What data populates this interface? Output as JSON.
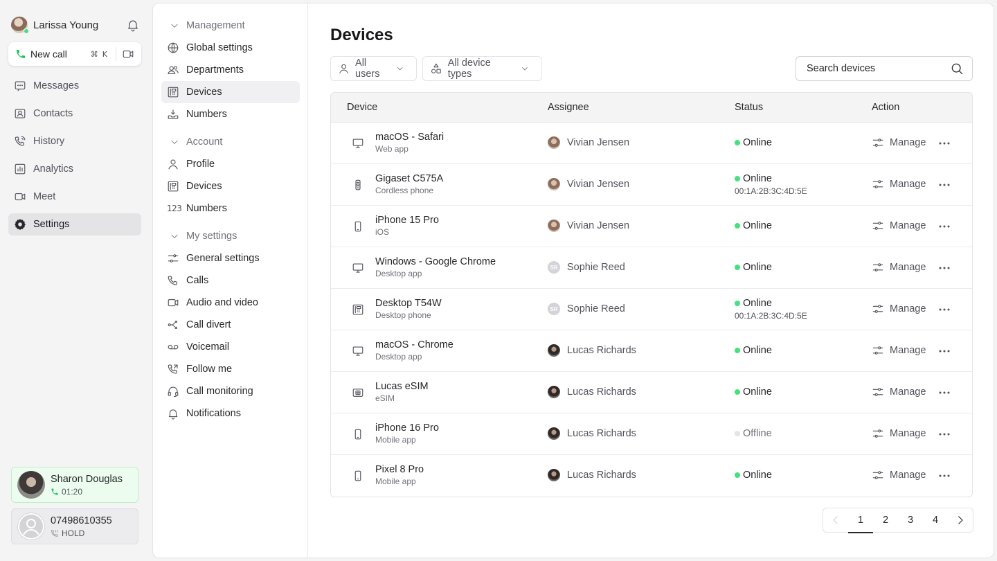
{
  "user": {
    "name": "Larissa Young",
    "status_color": "#4ade80"
  },
  "new_call": {
    "label": "New call",
    "shortcut_cmd": "⌘",
    "shortcut_key": "K"
  },
  "nav": [
    {
      "id": "messages",
      "label": "Messages",
      "icon": "chat-icon"
    },
    {
      "id": "contacts",
      "label": "Contacts",
      "icon": "contact-card-icon"
    },
    {
      "id": "history",
      "label": "History",
      "icon": "phone-history-icon"
    },
    {
      "id": "analytics",
      "label": "Analytics",
      "icon": "analytics-icon"
    },
    {
      "id": "meet",
      "label": "Meet",
      "icon": "video-icon"
    },
    {
      "id": "settings",
      "label": "Settings",
      "icon": "gear-icon",
      "active": true
    }
  ],
  "calls": {
    "active": {
      "name": "Sharon Douglas",
      "duration": "01:20"
    },
    "hold": {
      "name": "07498610355",
      "status": "HOLD"
    }
  },
  "subnav": {
    "management": {
      "title": "Management",
      "items": [
        "Global settings",
        "Departments",
        "Devices",
        "Numbers"
      ]
    },
    "account": {
      "title": "Account",
      "items": [
        "Profile",
        "Devices",
        "Numbers"
      ]
    },
    "my_settings": {
      "title": "My settings",
      "items": [
        "General settings",
        "Calls",
        "Audio and video",
        "Call divert",
        "Voicemail",
        "Follow me",
        "Call monitoring",
        "Notifications"
      ]
    }
  },
  "page": {
    "title": "Devices",
    "filters": {
      "users": "All users",
      "types": "All device types"
    },
    "search_placeholder": "Search devices"
  },
  "table": {
    "headers": {
      "device": "Device",
      "assignee": "Assignee",
      "status": "Status",
      "action": "Action"
    },
    "rows": [
      {
        "device": "macOS - Safari",
        "type": "Web app",
        "icon": "monitor-icon",
        "assignee": "Vivian Jensen",
        "avatar": "vj",
        "status": "Online",
        "mac": ""
      },
      {
        "device": "Gigaset C575A",
        "type": "Cordless phone",
        "icon": "cordless-phone-icon",
        "assignee": "Vivian Jensen",
        "avatar": "vj",
        "status": "Online",
        "mac": "00:1A:2B:3C:4D:5E"
      },
      {
        "device": "iPhone 15 Pro",
        "type": "iOS",
        "icon": "mobile-phone-icon",
        "assignee": "Vivian Jensen",
        "avatar": "vj",
        "status": "Online",
        "mac": ""
      },
      {
        "device": "Windows - Google Chrome",
        "type": "Desktop app",
        "icon": "monitor-icon",
        "assignee": "Sophie Reed",
        "avatar": "sr",
        "initials": "SR",
        "status": "Online",
        "mac": ""
      },
      {
        "device": "Desktop T54W",
        "type": "Desktop phone",
        "icon": "desk-phone-icon",
        "assignee": "Sophie Reed",
        "avatar": "sr",
        "initials": "SR",
        "status": "Online",
        "mac": "00:1A:2B:3C:4D:5E"
      },
      {
        "device": "macOS - Chrome",
        "type": "Desktop app",
        "icon": "monitor-icon",
        "assignee": "Lucas Richards",
        "avatar": "lr",
        "status": "Online",
        "mac": ""
      },
      {
        "device": "Lucas eSIM",
        "type": "eSIM",
        "icon": "esim-icon",
        "assignee": "Lucas Richards",
        "avatar": "lr",
        "status": "Online",
        "mac": ""
      },
      {
        "device": "iPhone 16 Pro",
        "type": "Mobile app",
        "icon": "mobile-phone-icon",
        "assignee": "Lucas Richards",
        "avatar": "lr",
        "status": "Offline",
        "mac": ""
      },
      {
        "device": "Pixel 8 Pro",
        "type": "Mobile app",
        "icon": "mobile-phone-icon",
        "assignee": "Lucas Richards",
        "avatar": "lr",
        "status": "Online",
        "mac": ""
      }
    ],
    "action_label": "Manage"
  },
  "pagination": {
    "pages": [
      "1",
      "2",
      "3",
      "4"
    ],
    "current": "1"
  },
  "colors": {
    "online": "#4ade80",
    "offline": "#e4e4e7",
    "active_call_bg": "#ecfdf0"
  }
}
